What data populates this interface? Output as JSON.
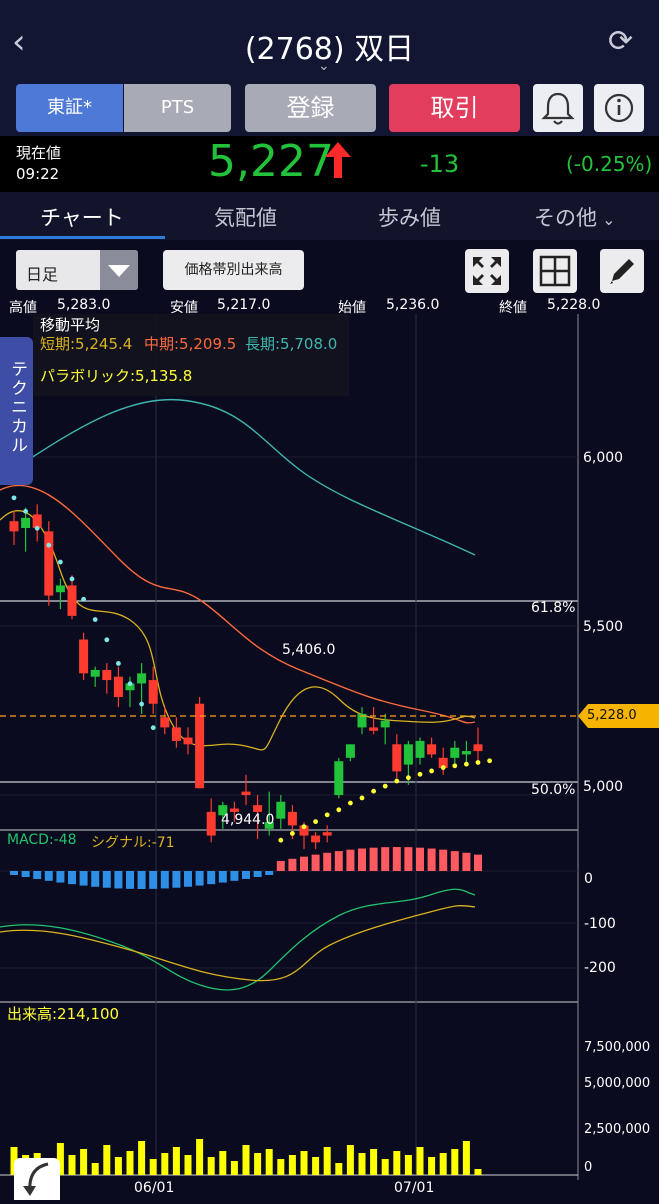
{
  "header": {
    "title": "(2768) 双日"
  },
  "market_tabs": {
    "tosho": "東証*",
    "pts": "PTS"
  },
  "actions": {
    "register": "登録",
    "trade": "取引"
  },
  "quote": {
    "now_label": "現在値",
    "time": "09:22",
    "price": "5,227",
    "change": "-13",
    "change_pct": "(-0.25%)",
    "up_color": "#22c33a",
    "arrow_color": "#ff2a2a"
  },
  "tabs": {
    "chart": "チャート",
    "kehai": "気配値",
    "ayumi": "歩み値",
    "other": "その他"
  },
  "toolbar": {
    "period": "日足",
    "volume_by_price": "価格帯別出来高"
  },
  "ohlc": {
    "high_label": "高値",
    "high": "5,283.0",
    "low_label": "安値",
    "low": "5,217.0",
    "open_label": "始値",
    "open": "5,236.0",
    "close_label": "終値",
    "close": "5,228.0"
  },
  "technical_tab": "テクニカル",
  "ma_legend": {
    "title": "移動平均",
    "short": "短期:5,245.4",
    "mid": "中期:5,209.5",
    "long": "長期:5,708.0",
    "parabolic": "パラボリック:5,135.8"
  },
  "chart_data": {
    "type": "candlestick",
    "price_axis_ticks": [
      "6,000",
      "5,500",
      "5,000"
    ],
    "fib_levels": [
      "61.8%",
      "50.0%"
    ],
    "annotations": {
      "high_mark": "5,406.0",
      "low_mark": "4,944.0",
      "current_tag": "5,228.0"
    },
    "macd_legend": {
      "macd": "MACD:-48",
      "signal": "シグナル:-71"
    },
    "macd_ticks": [
      "0",
      "-100",
      "-200"
    ],
    "volume_legend": "出来高:214,100",
    "volume_ticks": [
      "7,500,000",
      "5,000,000",
      "2,500,000",
      "0"
    ],
    "date_ticks": [
      "06/01",
      "07/01"
    ],
    "colors": {
      "up": "#22c33a",
      "down": "#ff3b30",
      "short_ma": "#d9b21f",
      "mid_ma": "#ff6a3d",
      "long_ma": "#3fb6b0",
      "parabolic_down": "#7fe6ea",
      "parabolic_up": "#ffff33",
      "macd_pos": "#ff5a5f",
      "macd_neg": "#2e8fe6",
      "volume": "#ffff00"
    },
    "candles": [
      {
        "o": 5810,
        "h": 5840,
        "l": 5740,
        "c": 5780
      },
      {
        "o": 5790,
        "h": 5850,
        "l": 5720,
        "c": 5820
      },
      {
        "o": 5830,
        "h": 5860,
        "l": 5750,
        "c": 5790
      },
      {
        "o": 5780,
        "h": 5810,
        "l": 5560,
        "c": 5590
      },
      {
        "o": 5600,
        "h": 5640,
        "l": 5550,
        "c": 5620
      },
      {
        "o": 5620,
        "h": 5650,
        "l": 5520,
        "c": 5530
      },
      {
        "o": 5460,
        "h": 5480,
        "l": 5340,
        "c": 5360
      },
      {
        "o": 5350,
        "h": 5380,
        "l": 5320,
        "c": 5370
      },
      {
        "o": 5370,
        "h": 5390,
        "l": 5300,
        "c": 5340
      },
      {
        "o": 5350,
        "h": 5380,
        "l": 5260,
        "c": 5290
      },
      {
        "o": 5310,
        "h": 5350,
        "l": 5260,
        "c": 5330
      },
      {
        "o": 5330,
        "h": 5390,
        "l": 5240,
        "c": 5360
      },
      {
        "o": 5340,
        "h": 5380,
        "l": 5240,
        "c": 5270
      },
      {
        "o": 5230,
        "h": 5260,
        "l": 5180,
        "c": 5200
      },
      {
        "o": 5200,
        "h": 5230,
        "l": 5140,
        "c": 5160
      },
      {
        "o": 5170,
        "h": 5200,
        "l": 5120,
        "c": 5150
      },
      {
        "o": 5270,
        "h": 5290,
        "l": 5020,
        "c": 5020
      },
      {
        "o": 4950,
        "h": 4990,
        "l": 4860,
        "c": 4880
      },
      {
        "o": 4940,
        "h": 4980,
        "l": 4900,
        "c": 4970
      },
      {
        "o": 4960,
        "h": 4980,
        "l": 4920,
        "c": 4950
      },
      {
        "o": 5010,
        "h": 5060,
        "l": 4970,
        "c": 5000
      },
      {
        "o": 4970,
        "h": 5000,
        "l": 4870,
        "c": 4950
      },
      {
        "o": 4900,
        "h": 5010,
        "l": 4880,
        "c": 4920
      },
      {
        "o": 4930,
        "h": 5000,
        "l": 4900,
        "c": 4980
      },
      {
        "o": 4950,
        "h": 4970,
        "l": 4870,
        "c": 4910
      },
      {
        "o": 4910,
        "h": 4920,
        "l": 4840,
        "c": 4880
      },
      {
        "o": 4880,
        "h": 4890,
        "l": 4840,
        "c": 4860
      },
      {
        "o": 4890,
        "h": 4910,
        "l": 4860,
        "c": 4880
      },
      {
        "o": 5000,
        "h": 5110,
        "l": 4990,
        "c": 5100
      },
      {
        "o": 5110,
        "h": 5150,
        "l": 5100,
        "c": 5150
      },
      {
        "o": 5200,
        "h": 5260,
        "l": 5180,
        "c": 5240
      },
      {
        "o": 5200,
        "h": 5260,
        "l": 5180,
        "c": 5190
      },
      {
        "o": 5200,
        "h": 5240,
        "l": 5150,
        "c": 5220
      },
      {
        "o": 5150,
        "h": 5180,
        "l": 5050,
        "c": 5070
      },
      {
        "o": 5090,
        "h": 5160,
        "l": 5030,
        "c": 5150
      },
      {
        "o": 5110,
        "h": 5170,
        "l": 5090,
        "c": 5160
      },
      {
        "o": 5150,
        "h": 5170,
        "l": 5110,
        "c": 5120
      },
      {
        "o": 5110,
        "h": 5140,
        "l": 5060,
        "c": 5080
      },
      {
        "o": 5110,
        "h": 5160,
        "l": 5080,
        "c": 5140
      },
      {
        "o": 5120,
        "h": 5160,
        "l": 5090,
        "c": 5130
      },
      {
        "o": 5150,
        "h": 5200,
        "l": 5100,
        "c": 5130
      }
    ],
    "parabolic_down": [
      5820,
      5780,
      5730,
      5680,
      5630,
      5580,
      5520,
      5460,
      5400,
      5330,
      5270,
      5210,
      5140
    ],
    "parabolic_up": [
      4955,
      4975,
      4995,
      5010,
      5030,
      5045,
      5065,
      5080,
      5100,
      5115,
      5130,
      5140,
      5150,
      5160,
      5170,
      5175,
      5180,
      5185,
      5190
    ]
  }
}
